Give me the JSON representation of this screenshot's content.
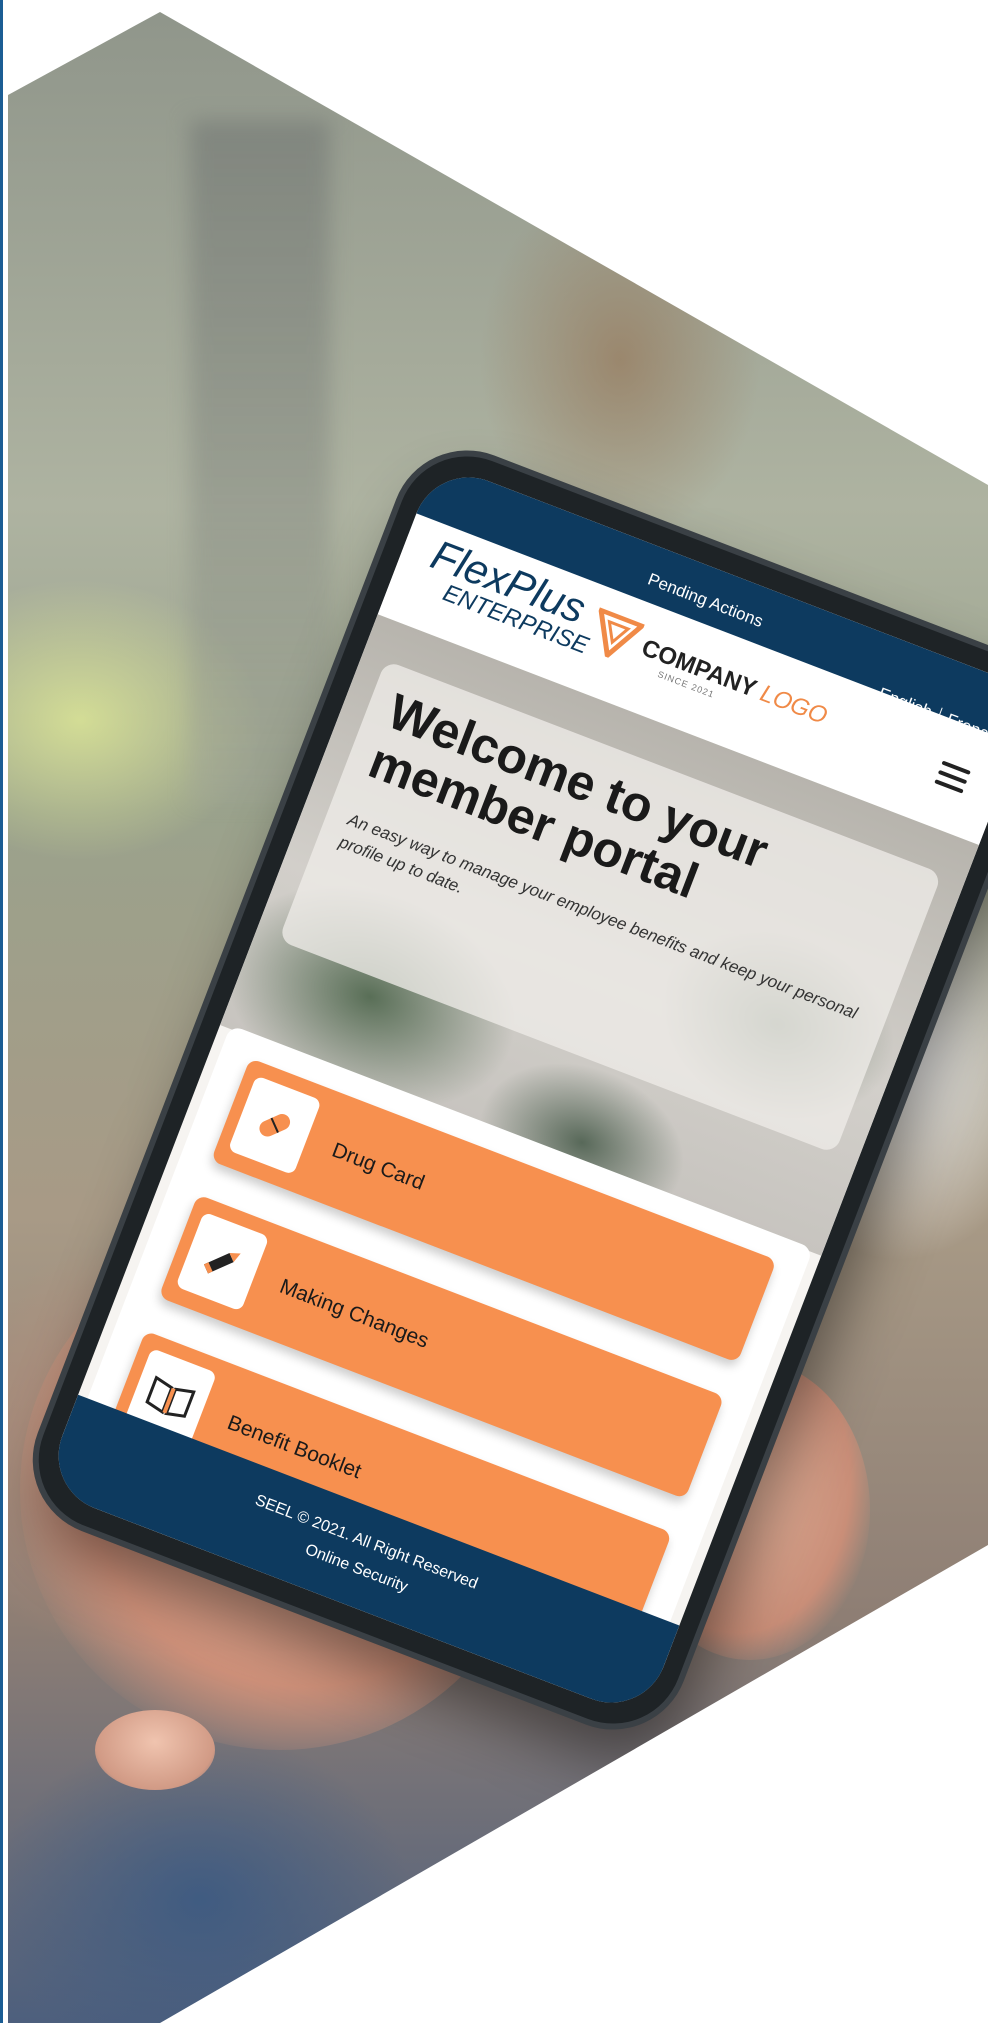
{
  "topbar": {
    "pending": "Pending Actions",
    "lang_en": "English",
    "lang_fr": "French"
  },
  "brand": {
    "line1": "FlexPlus",
    "line2": "ENTERPRISE"
  },
  "company": {
    "name_part1": "COMPANY",
    "name_part2": "LOGO",
    "since": "SINCE 2021"
  },
  "hero": {
    "title": "Welcome to your member portal",
    "subtitle": "An easy way to manage your employee benefits and keep your personal profile up to date."
  },
  "actions": [
    {
      "label": "Drug Card",
      "icon": "pill-icon"
    },
    {
      "label": "Making Changes",
      "icon": "pencil-icon"
    },
    {
      "label": "Benefit Booklet",
      "icon": "book-icon"
    }
  ],
  "footer": {
    "copyright": "SEEL © 2021. All Right Reserved",
    "link": "Online Security"
  },
  "colors": {
    "navy": "#0d3a5f",
    "orange": "#f7904f"
  }
}
